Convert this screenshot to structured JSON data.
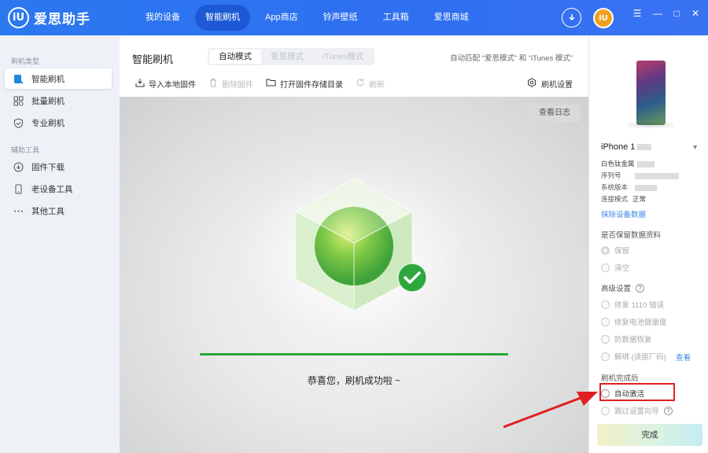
{
  "app": {
    "name": "爱思助手",
    "logo_mark": "iU"
  },
  "nav": [
    {
      "label": "我的设备"
    },
    {
      "label": "智能刷机",
      "active": true
    },
    {
      "label": "App商店"
    },
    {
      "label": "铃声壁纸"
    },
    {
      "label": "工具箱"
    },
    {
      "label": "爱思商城"
    }
  ],
  "topbar": {
    "avatar_mark": "iU",
    "minimize": "—",
    "restore": "□",
    "close": "✕",
    "menu": "☰"
  },
  "sidebar": {
    "section1": "刷机类型",
    "items1": [
      {
        "label": "智能刷机",
        "icon": "smart-flash-icon"
      },
      {
        "label": "批量刷机",
        "icon": "batch-flash-icon"
      },
      {
        "label": "专业刷机",
        "icon": "pro-flash-icon"
      }
    ],
    "section2": "辅助工具",
    "items2": [
      {
        "label": "固件下载",
        "icon": "firmware-download-icon"
      },
      {
        "label": "老设备工具",
        "icon": "old-device-icon"
      },
      {
        "label": "其他工具",
        "icon": "more-icon"
      }
    ]
  },
  "main": {
    "title": "智能刷机",
    "tabs": [
      {
        "label": "自动模式",
        "active": true
      },
      {
        "label": "爱思模式"
      },
      {
        "label": "iTunes模式"
      }
    ],
    "auto_match": "自动匹配 “爱思模式” 和 “iTunes 模式”",
    "toolbar": {
      "import": "导入本地固件",
      "delete": "删除固件",
      "open_dir": "打开固件存储目录",
      "refresh": "刷新",
      "settings": "刷机设置"
    },
    "log_button": "查看日志",
    "progress": 1.0,
    "success_text": "恭喜您，刷机成功啦 ~"
  },
  "device": {
    "name": "iPhone 1",
    "color": "白色钛金属",
    "serial_label": "序列号",
    "version_label": "系统版本",
    "mode_label": "连接模式",
    "mode_value": "正常",
    "erase_link": "抹除设备数据"
  },
  "options": {
    "keep_data_title": "是否保留数据资料",
    "keep": "保留",
    "clear": "清空",
    "advanced_title": "高级设置",
    "fix_1110": "修复 1110 错误",
    "fix_battery": "修复电池健康度",
    "anti_recovery": "防数据恢复",
    "unbind": "解绑 (读原厂码)",
    "view_link": "查看",
    "after_title": "刷机完成后",
    "auto_activate": "自动激活",
    "skip_wizard": "跳过设置向导",
    "done_button": "完成"
  },
  "colors": {
    "brand": "#2c78f0",
    "success": "#2aa834",
    "link": "#3c86e6",
    "annotation": "#e02020"
  }
}
